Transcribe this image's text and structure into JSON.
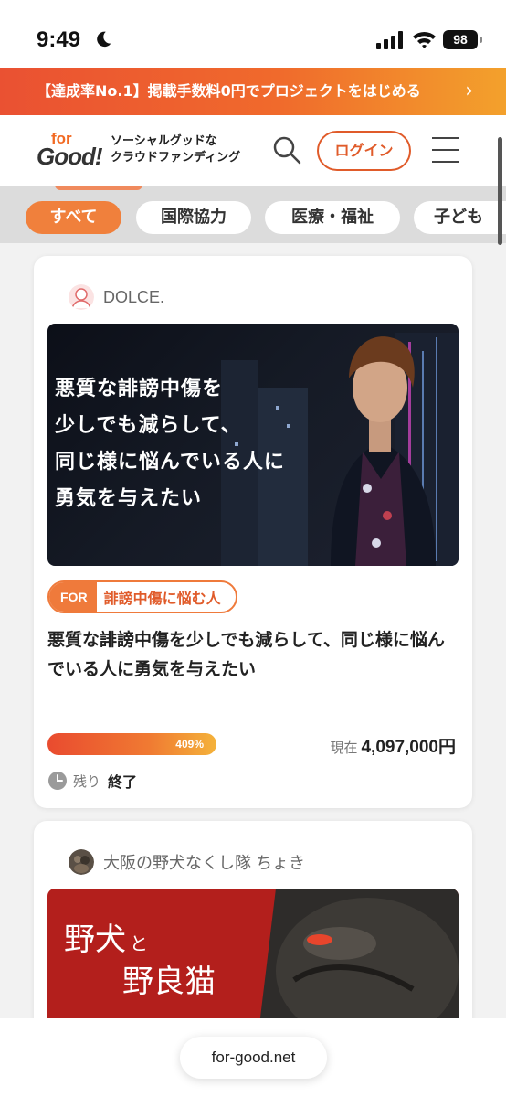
{
  "status_bar": {
    "time": "9:49",
    "battery": "98"
  },
  "promo": {
    "text": "【達成率No.1】掲載手数料0円でプロジェクトをはじめる",
    "arrow": "›"
  },
  "header": {
    "logo_for": "for",
    "logo_good": "Good!",
    "tagline_line1": "ソーシャルグッドな",
    "tagline_line2": "クラウドファンディング",
    "login_label": "ログイン"
  },
  "tabs": [
    {
      "label": "すべて",
      "active": true
    },
    {
      "label": "国際協力"
    },
    {
      "label": "医療・福祉"
    },
    {
      "label": "子ども"
    }
  ],
  "cards": [
    {
      "owner": "DOLCE.",
      "image_text": [
        "悪質な誹謗中傷を",
        "少しでも減らして、",
        "同じ様に悩んでいる人に",
        "勇気を与えたい"
      ],
      "for_label": "FOR",
      "target": "誹謗中傷に悩む人",
      "title": "悪質な誹謗中傷を少しでも減らして、同じ様に悩んでいる人に勇気を与えたい",
      "progress_label": "409%",
      "progress_fill": 1.0,
      "raised_label": "現在",
      "raised_amount": "4,097,000円",
      "remaining_label": "残り",
      "remaining_value": "終了"
    },
    {
      "owner": "大阪の野犬なくし隊 ちょき",
      "image_text_1": "野犬",
      "image_text_small": "と",
      "image_text_2": "野良猫"
    }
  ],
  "url_bar": {
    "url": "for-good.net"
  },
  "colors": {
    "accent": "#f0803c",
    "brand_orange": "#e05b2a",
    "card_red": "#b31f1c"
  }
}
